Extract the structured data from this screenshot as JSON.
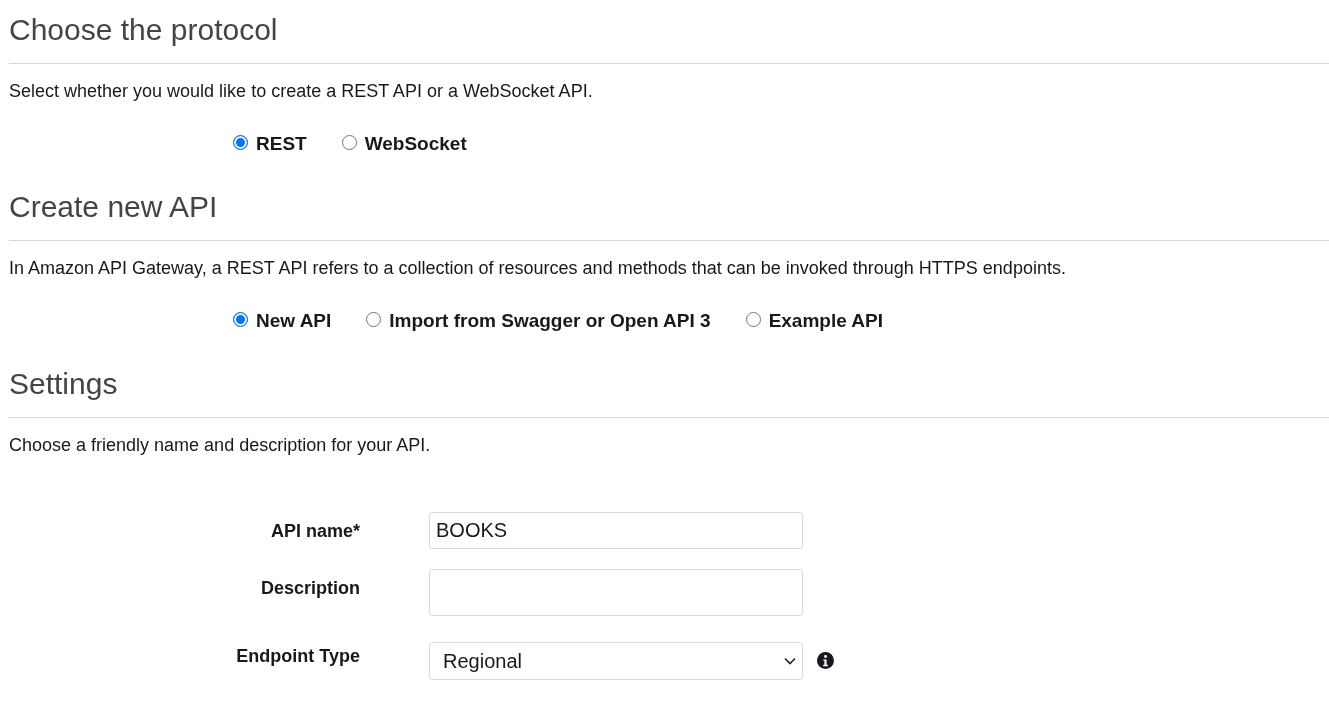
{
  "sections": [
    {
      "title": "Choose the protocol",
      "description": "Select whether you would like to create a REST API or a WebSocket API.",
      "options": [
        {
          "label": "REST",
          "selected": true
        },
        {
          "label": "WebSocket",
          "selected": false
        }
      ]
    },
    {
      "title": "Create new API",
      "description": "In Amazon API Gateway, a REST API refers to a collection of resources and methods that can be invoked through HTTPS endpoints.",
      "options": [
        {
          "label": "New API",
          "selected": true
        },
        {
          "label": "Import from Swagger or Open API 3",
          "selected": false
        },
        {
          "label": "Example API",
          "selected": false
        }
      ]
    },
    {
      "title": "Settings",
      "description": "Choose a friendly name and description for your API.",
      "fields": [
        {
          "kind": "text",
          "label": "API name*",
          "value": "BOOKS",
          "info": false
        },
        {
          "kind": "textarea",
          "label": "Description",
          "info": false
        },
        {
          "kind": "select",
          "label": "Endpoint Type",
          "value": "Regional",
          "info": true
        }
      ]
    }
  ]
}
